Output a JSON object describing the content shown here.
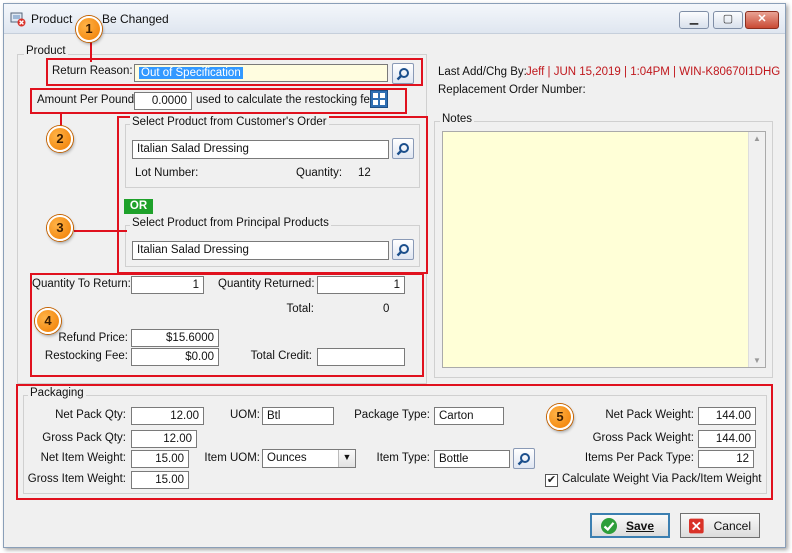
{
  "window": {
    "title": "Product Will Be Changed",
    "title_prefix": "Product ",
    "title_suffix": "Be Changed",
    "minimize": "▁",
    "maximize": "▢",
    "close": "✕"
  },
  "product_group": {
    "legend": "Product",
    "return_reason_label": "Return Reason:",
    "return_reason_value": "Out of Specification",
    "amount_per_pound_label": "Amount Per Pound:",
    "amount_per_pound_value": "0.0000",
    "amount_note": "used to calculate the restocking fee."
  },
  "customer_order": {
    "legend": "Select Product from Customer's Order",
    "product_value": "Italian Salad Dressing",
    "lot_label": "Lot Number:",
    "quantity_label": "Quantity:",
    "quantity_value": "12"
  },
  "or_label": "OR",
  "principal_products": {
    "legend": "Select Product from Principal Products",
    "product_value": "Italian Salad Dressing"
  },
  "quantities": {
    "qty_to_return_label": "Quantity To Return:",
    "qty_to_return_value": "1",
    "qty_returned_label": "Quantity Returned:",
    "qty_returned_value": "1",
    "total_label": "Total:",
    "total_value": "0",
    "refund_price_label": "Refund Price:",
    "refund_price_value": "$15.6000",
    "restocking_fee_label": "Restocking Fee:",
    "restocking_fee_value": "$0.00",
    "total_credit_label": "Total Credit:",
    "total_credit_value": ""
  },
  "info": {
    "last_add_label": "Last Add/Chg By:",
    "last_add_value": "Jeff | JUN 15,2019 |  1:04PM | WIN-K80670I1DHG",
    "replacement_label": "Replacement Order Number:"
  },
  "notes": {
    "label": "Notes",
    "value": ""
  },
  "packaging": {
    "legend": "Packaging",
    "net_pack_qty_label": "Net Pack Qty:",
    "net_pack_qty_value": "12.00",
    "gross_pack_qty_label": "Gross Pack Qty:",
    "gross_pack_qty_value": "12.00",
    "net_item_weight_label": "Net Item Weight:",
    "net_item_weight_value": "15.00",
    "gross_item_weight_label": "Gross Item Weight:",
    "gross_item_weight_value": "15.00",
    "uom_label": "UOM:",
    "uom_value": "Btl",
    "item_uom_label": "Item UOM:",
    "item_uom_value": "Ounces",
    "package_type_label": "Package Type:",
    "package_type_value": "Carton",
    "item_type_label": "Item Type:",
    "item_type_value": "Bottle",
    "net_pack_weight_label": "Net Pack Weight:",
    "net_pack_weight_value": "144.00",
    "gross_pack_weight_label": "Gross Pack Weight:",
    "gross_pack_weight_value": "144.00",
    "items_per_pack_type_label": "Items Per Pack Type:",
    "items_per_pack_type_value": "12",
    "calc_weight_label": "Calculate Weight Via Pack/Item Weight",
    "calc_weight_checked": true
  },
  "callouts": [
    "1",
    "2",
    "3",
    "4",
    "5"
  ],
  "buttons": {
    "save": "Save",
    "cancel": "Cancel"
  },
  "colors": {
    "highlight_red": "#e0111e",
    "callout_orange": "#f07c00",
    "or_green": "#1ea12a",
    "notes_yellow": "#ffffd7"
  }
}
